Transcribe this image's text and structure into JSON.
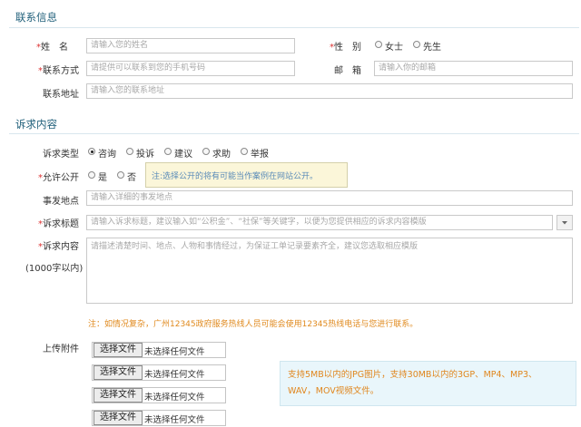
{
  "contact": {
    "section_title": "联系信息",
    "name_label": "姓　名",
    "name_placeholder": "请输入您的姓名",
    "gender_label": "性　别",
    "gender_options": [
      "女士",
      "先生"
    ],
    "phone_label": "联系方式",
    "phone_placeholder": "请提供可以联系到您的手机号码",
    "email_label": "邮　箱",
    "email_placeholder": "请输入你的邮箱",
    "address_label": "联系地址",
    "address_placeholder": "请输入您的联系地址"
  },
  "request": {
    "section_title": "诉求内容",
    "type_label": "诉求类型",
    "type_options": [
      "咨询",
      "投诉",
      "建议",
      "求助",
      "举报"
    ],
    "type_selected": "咨询",
    "public_label": "允许公开",
    "public_options": [
      "是",
      "否"
    ],
    "public_tip": "注:选择公开的将有可能当作案例在网站公开。",
    "location_label": "事发地点",
    "location_placeholder": "请输入详细的事发地点",
    "title_label": "诉求标题",
    "title_placeholder": "请输入诉求标题，建议输入如“公积金”、“社保”等关键字，以便为您提供相应的诉求内容模版",
    "content_label": "诉求内容",
    "content_sublabel": "(1000字以内)",
    "content_placeholder": "请描述清楚时间、地点、人物和事情经过，为保证工单记录要素齐全，建议您选取相应模版",
    "hotline_note": "注：如情况复杂，广州12345政府服务热线人员可能会使用12345热线电话与您进行联系。"
  },
  "attachments": {
    "label": "上传附件",
    "choose_label": "选择文件",
    "no_file_label": "未选择任何文件",
    "info_line1": "支持5MB以内的JPG图片，支持30MB以内的3GP、MP4、MP3、",
    "info_line2": "WAV，MOV视频文件。"
  },
  "icons": {
    "dropdown": "chevron-down-icon"
  }
}
